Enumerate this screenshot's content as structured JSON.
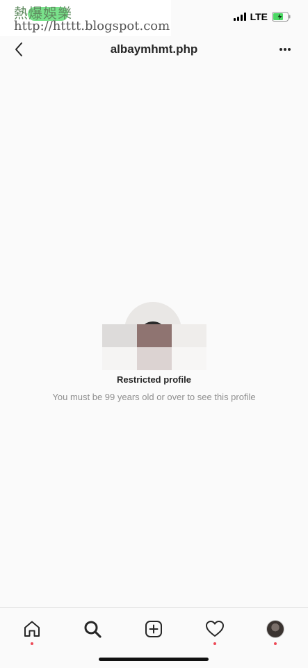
{
  "watermark": {
    "title": "熱爆娛樂",
    "url": "http://htttt.blogspot.com"
  },
  "status_bar": {
    "network": "LTE",
    "battery_color": "#4cd864"
  },
  "header": {
    "title": "albaymhmt.php",
    "back_icon": "chevron-left-icon",
    "more_icon": "ellipsis-icon"
  },
  "profile": {
    "restricted_title": "Restricted profile",
    "restricted_message": "You must be 99 years old or over to see this profile"
  },
  "tab_bar": {
    "tabs": [
      {
        "name": "home",
        "icon": "home-icon",
        "notification_dot": true
      },
      {
        "name": "search",
        "icon": "search-icon",
        "notification_dot": false
      },
      {
        "name": "new-post",
        "icon": "plus-square-icon",
        "notification_dot": false
      },
      {
        "name": "activity",
        "icon": "heart-icon",
        "notification_dot": true
      },
      {
        "name": "profile",
        "icon": "profile-avatar",
        "notification_dot": true
      }
    ],
    "dot_color": "#ed4956"
  }
}
